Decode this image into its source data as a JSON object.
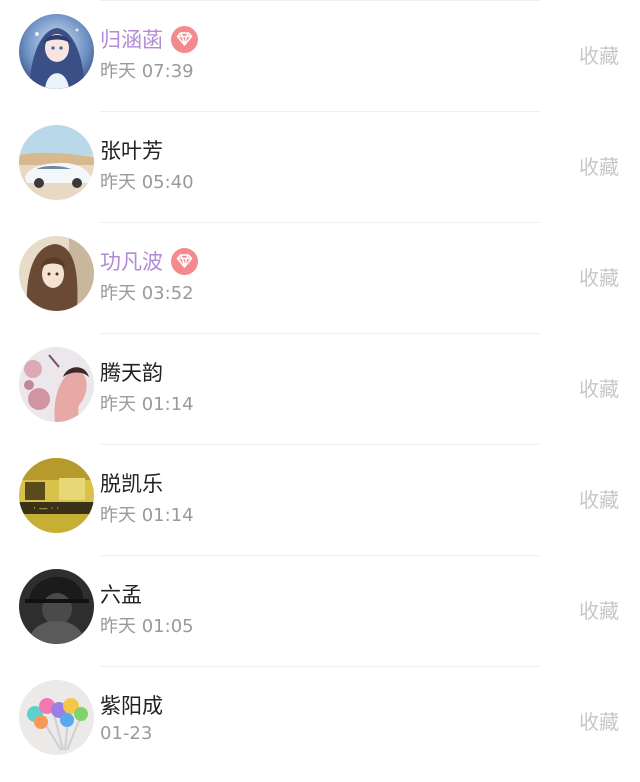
{
  "list": {
    "items": [
      {
        "name": "归涵菡",
        "vip": true,
        "time": "昨天 07:39",
        "action": "收藏",
        "avatar": "anime-girl-blue-hair"
      },
      {
        "name": "张叶芳",
        "vip": false,
        "time": "昨天 05:40",
        "action": "收藏",
        "avatar": "white-sports-car"
      },
      {
        "name": "功凡波",
        "vip": true,
        "time": "昨天 03:52",
        "action": "收藏",
        "avatar": "anime-girl-brown-hair"
      },
      {
        "name": "腾天韵",
        "vip": false,
        "time": "昨天 01:14",
        "action": "收藏",
        "avatar": "pink-artwork-portrait"
      },
      {
        "name": "脱凯乐",
        "vip": false,
        "time": "昨天 01:14",
        "action": "收藏",
        "avatar": "yellow-shop-scene"
      },
      {
        "name": "六孟",
        "vip": false,
        "time": "昨天 01:05",
        "action": "收藏",
        "avatar": "dark-portrait"
      },
      {
        "name": "紫阳成",
        "vip": false,
        "time": "01-23",
        "action": "收藏",
        "avatar": "colorful-lollipops"
      }
    ]
  },
  "colors": {
    "vip_name": "#b38ad6",
    "vip_badge": "#f48a8e",
    "name": "#222222",
    "time": "#9a9a9a",
    "action": "#c7c7c7"
  },
  "icons": {
    "vip_badge": "diamond-icon"
  }
}
